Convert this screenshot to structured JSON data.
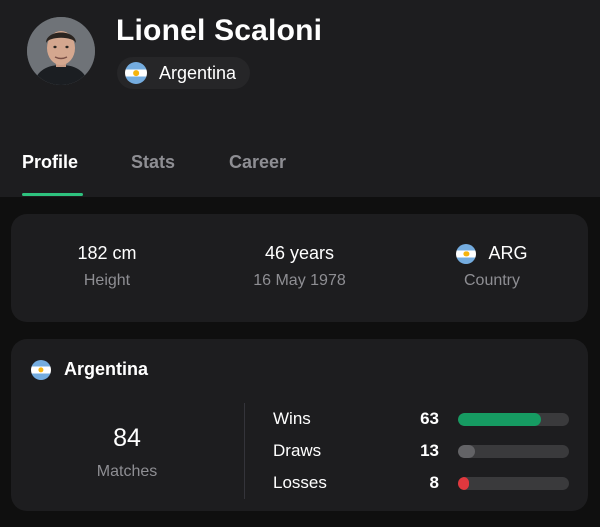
{
  "profile": {
    "name": "Lionel Scaloni",
    "nationality": "Argentina"
  },
  "tabs": [
    {
      "label": "Profile",
      "active": true
    },
    {
      "label": "Stats",
      "active": false
    },
    {
      "label": "Career",
      "active": false
    }
  ],
  "info": {
    "height_value": "182 cm",
    "height_label": "Height",
    "age_value": "46 years",
    "birth_date": "16 May 1978",
    "country_code": "ARG",
    "country_label": "Country"
  },
  "team": {
    "name": "Argentina",
    "matches_value": "84",
    "matches_label": "Matches",
    "records": [
      {
        "label": "Wins",
        "value": "63",
        "fraction": 0.75,
        "color": "#169b62"
      },
      {
        "label": "Draws",
        "value": "13",
        "fraction": 0.15,
        "color": "#636366"
      },
      {
        "label": "Losses",
        "value": "8",
        "fraction": 0.1,
        "color": "#e0383e"
      }
    ]
  },
  "colors": {
    "accent": "#2ec27e",
    "background": "#0f0f0f",
    "card": "#1d1d1f",
    "muted_text": "#8e8e93"
  },
  "icons": {
    "flag": "argentina-flag-icon",
    "avatar": "manager-avatar"
  }
}
